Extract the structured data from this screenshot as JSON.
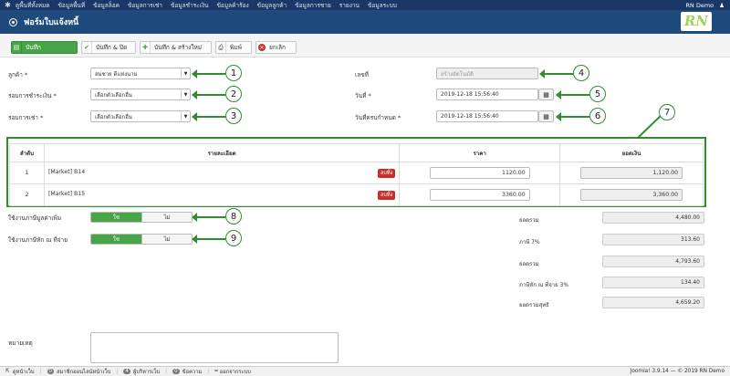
{
  "topnav": {
    "items": [
      "ดูพื้นที่ทั้งหมด",
      "ข้อมูลพื้นที่",
      "ข้อมูลล็อค",
      "ข้อมูลการเช่า",
      "ข้อมูลชำระเงิน",
      "ข้อมูลค้าร้อง",
      "ข้อมูลลูกค้า",
      "ข้อมูลการชาย",
      "รายงาน",
      "ข้อมูลระบบ"
    ],
    "user": "RN Demo"
  },
  "header": {
    "title": "ฟอร์มใบแจ้งหนี้",
    "logo": "RN"
  },
  "toolbar": {
    "save": "บันทึก",
    "save_close": "บันทึก & ปิด",
    "save_new": "บันทึก & สร้างใหม่",
    "print": "พิมพ์",
    "cancel": "ยกเลิก"
  },
  "form": {
    "customer_label": "ลูกค้า *",
    "customer_value": "สมชาย ดีแห่งนาม",
    "payment_cycle_label": "รอบการชำระเงิน *",
    "payment_cycle_value": "เลือกตัวเลือกอื่น",
    "rent_cycle_label": "รอบการเช่า *",
    "rent_cycle_value": "เลือกตัวเลือกอื่น",
    "number_label": "เลขที่",
    "number_placeholder": "สร้างอัตโนมัติ",
    "date_label": "วันที่ *",
    "date_value": "2019-12-18 15:56:40",
    "due_label": "วันที่ครบกำหนด *",
    "due_value": "2019-12-18 15:56:40"
  },
  "annotations": [
    "1",
    "2",
    "3",
    "4",
    "5",
    "6",
    "7",
    "8",
    "9"
  ],
  "table": {
    "headers": [
      "ลำดับ",
      "รายละเอียด",
      "ราคา",
      "ยอดเงิน"
    ],
    "delete_label": "ลบทิ้ง",
    "rows": [
      {
        "no": "1",
        "detail": "[Market] B14",
        "price": "1120.00",
        "amount": "1,120.00"
      },
      {
        "no": "2",
        "detail": "[Market] B15",
        "price": "3360.00",
        "amount": "3,360.00"
      }
    ]
  },
  "toggles": {
    "vat_label": "ใช้งานภาษีมูลค่าเพิ่ม",
    "wht_label": "ใช้งานภาษีหัก ณ ที่จ่าย",
    "yes": "ใช่",
    "no": "ไม่"
  },
  "summary": [
    {
      "label": "ยอดรวม",
      "value": "4,480.00"
    },
    {
      "label": "ภาษี 7%",
      "value": "313.60"
    },
    {
      "label": "ยอดรวม",
      "value": "4,793.60"
    },
    {
      "label": "ภาษีหัก ณ ที่จ่าย 3%",
      "value": "134.40"
    },
    {
      "label": "ยอดรวมสุทธิ",
      "value": "4,659.20"
    }
  ],
  "remark_label": "หมายเหตุ",
  "footer": {
    "view_site": "ดูหน้าเว็บ",
    "visitors_count": "0",
    "visitors_label": "สมาชิกออนไลน์หน้าเว็บ",
    "admins_count": "4",
    "admins_label": "ผู้บริหารเว็บ",
    "messages_count": "0",
    "messages_label": "ข้อความ",
    "logout": "ออกจากระบบ",
    "version": "Joomla! 3.9.14 — © 2019 RN Demo"
  }
}
